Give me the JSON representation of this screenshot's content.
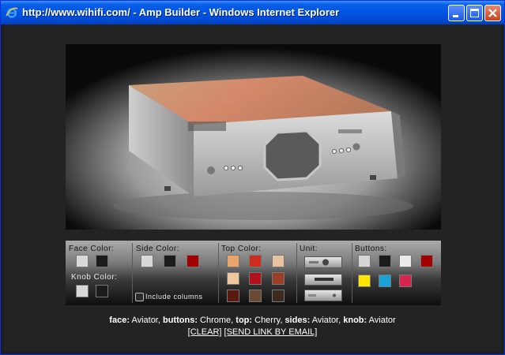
{
  "window": {
    "title": "http://www.wihifi.com/ - Amp Builder - Windows Internet Explorer"
  },
  "icons": {
    "browser": "ie-icon",
    "minimize": "minimize-icon",
    "maximize": "maximize-icon",
    "close": "close-icon"
  },
  "builder": {
    "face_label": "Face Color:",
    "knob_label": "Knob Color:",
    "side_label": "Side Color:",
    "top_label": "Top Color:",
    "unit_label": "Unit:",
    "buttons_label": "Buttons:",
    "include_columns": "Include columns",
    "face_swatches": [
      "#d8d8d8",
      "#1c1c1c"
    ],
    "knob_swatches": [
      "#d8d8d8",
      "#1c1c1c"
    ],
    "side_swatches": [
      "#d8d8d8",
      "#1c1c1c",
      "#a00000"
    ],
    "top_swatches": [
      "#e9a46a",
      "#cc2d1e",
      "#e6c4a3",
      "#efc79c",
      "#b2101a",
      "#9c3d26",
      "#5a1b0c",
      "#6b4a34",
      "#3b2a20"
    ],
    "button_swatches": [
      "#d6d6d6",
      "#1c1c1c",
      "#ebebeb",
      "#a00000",
      "#ffe600",
      "#1aa3d6",
      "#d8254d"
    ]
  },
  "status": {
    "face_key": "face:",
    "face_val": "Aviator,",
    "buttons_key": "buttons:",
    "buttons_val": "Chrome,",
    "top_key": "top:",
    "top_val": "Cherry,",
    "sides_key": "sides:",
    "sides_val": "Aviator,",
    "knob_key": "knob:",
    "knob_val": "Aviator",
    "clear_link": "[CLEAR]",
    "email_link": "[SEND LINK BY EMAIL]"
  }
}
